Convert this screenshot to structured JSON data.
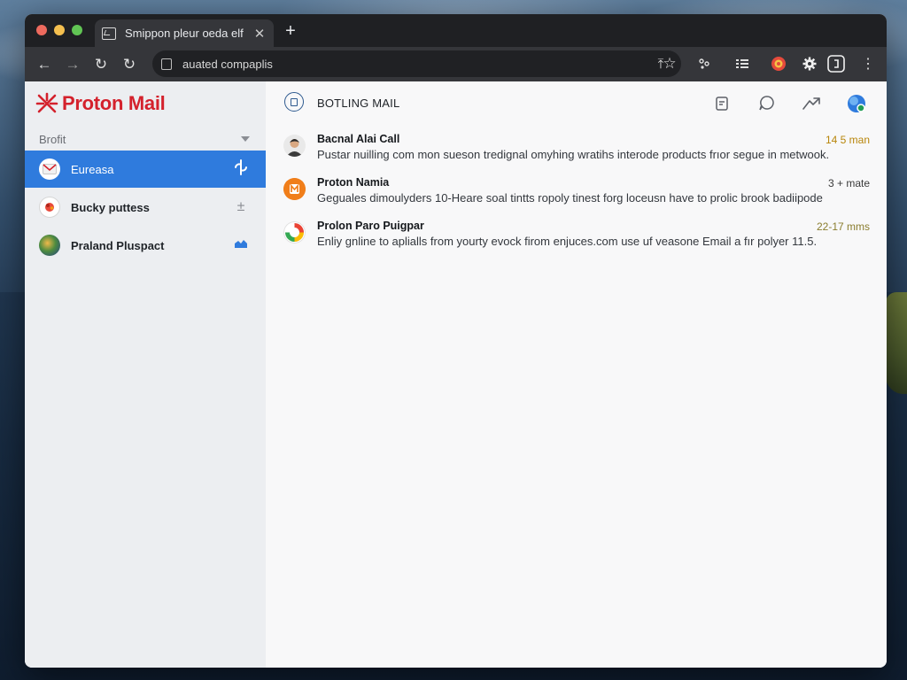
{
  "browser": {
    "tab_title": "Smippon pleur oeda elf",
    "tab_close_icon": "close-icon",
    "new_tab_icon": "plus-icon",
    "address": "auated compaplis",
    "nav": [
      "back-icon",
      "forward-icon",
      "reload-icon",
      "reload-icon"
    ],
    "extensions": [
      "extension-icon",
      "list-icon",
      "circle-badge-icon",
      "gear-icon",
      "square-badge-icon",
      "more-vertical-icon"
    ]
  },
  "sidebar": {
    "brand": "Proton Mail",
    "brand_color": "#d4212c",
    "folder_select": "Brofit",
    "accounts": [
      {
        "label": "Eureasa",
        "active": true,
        "action_icon": "sync-icon"
      },
      {
        "label": "Bucky puttess",
        "active": false,
        "action_icon": "plus-minus-icon"
      },
      {
        "label": "Praland Pluspact",
        "active": false,
        "action_icon": "cloud-icon"
      }
    ],
    "active_color": "#2f7bdd"
  },
  "main": {
    "title": "BOTLING MAIL",
    "header_actions": [
      "note-icon",
      "comment-icon",
      "share-icon",
      "profile-icon"
    ],
    "messages": [
      {
        "sender": "Bacnal Alai Call",
        "time": "14 5 man",
        "time_color": "#b8860b",
        "preview": "Pustar nuilling com mon sueson tredignal omyhing wratihs interode products frıor segue in metwook."
      },
      {
        "sender": "Proton Namia",
        "time": "3 + mate",
        "time_color": "#c0392b",
        "preview": "Geguales dimoulyders 10-Heare soal tintts ropoly tinest forg loceusn have to prolic brook badiipode"
      },
      {
        "sender": "Prolon Paro Puigpar",
        "time": "22-17 mms",
        "time_color": "#8a7d2e",
        "preview": "Enliy gnline to aplialls from yourty evock firom enjuces.com use uf veasone Email a fır polyer 11.5."
      }
    ]
  }
}
